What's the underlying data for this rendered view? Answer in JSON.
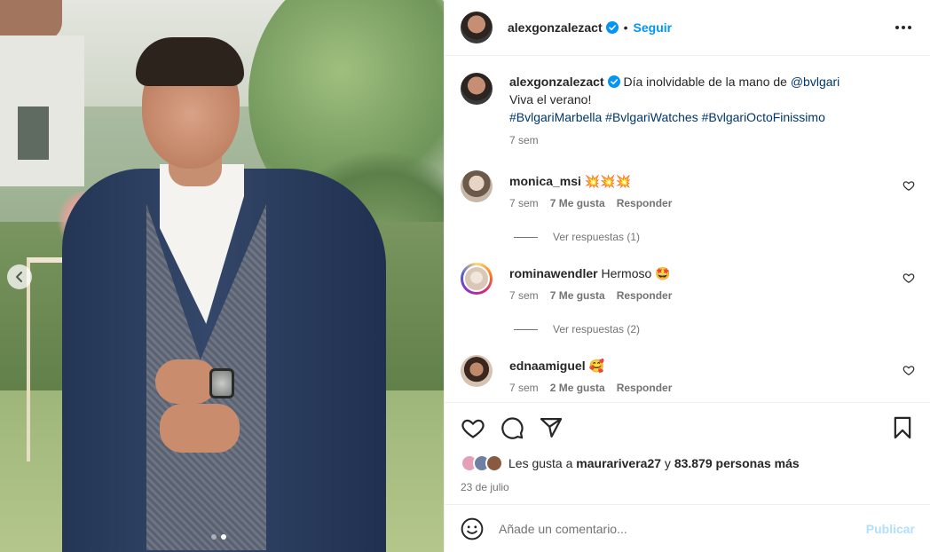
{
  "post": {
    "username": "alexgonzalezact",
    "follow_label": "Seguir",
    "dot": "•"
  },
  "caption": {
    "username": "alexgonzalezact",
    "text_before": "Día inolvidable de la mano de ",
    "mention": "@bvlgari",
    "line2": "Viva el verano!",
    "hashtags": [
      "#BvlgariMarbella",
      "#BvlgariWatches",
      "#BvlgariOctoFinissimo"
    ],
    "time": "7 sem"
  },
  "comments": [
    {
      "username": "monica_msi",
      "text": "💥💥💥",
      "time": "7 sem",
      "likes": "7 Me gusta",
      "reply": "Responder",
      "view_replies": "Ver respuestas (1)",
      "avatar_color": "#c7b8a9"
    },
    {
      "username": "rominawendler",
      "text": "Hermoso 🤩",
      "time": "7 sem",
      "likes": "7 Me gusta",
      "reply": "Responder",
      "view_replies": "Ver respuestas (2)",
      "avatar_color": "#e9ddd2"
    },
    {
      "username": "ednaamiguel",
      "text": "🥰",
      "time": "7 sem",
      "likes": "2 Me gusta",
      "reply": "Responder",
      "avatar_color": "#5b3b2c"
    }
  ],
  "likes": {
    "prefix": "Les gusta a ",
    "user": "maurarivera27",
    "middle": " y ",
    "count": "83.879 personas más"
  },
  "date": "23 de julio",
  "add_comment": {
    "placeholder": "Añade un comentario...",
    "publish_label": "Publicar"
  },
  "icons": {
    "verified": "verified-badge-icon",
    "more": "more-options-icon",
    "like": "heart-icon",
    "comment": "comment-icon",
    "share": "paper-plane-icon",
    "save": "bookmark-icon",
    "emoji": "emoji-icon",
    "carousel_prev": "chevron-left-icon"
  },
  "colors": {
    "accent": "#0095f6",
    "link": "#00376b",
    "muted": "#737373",
    "publish_disabled": "#b2dffc"
  }
}
